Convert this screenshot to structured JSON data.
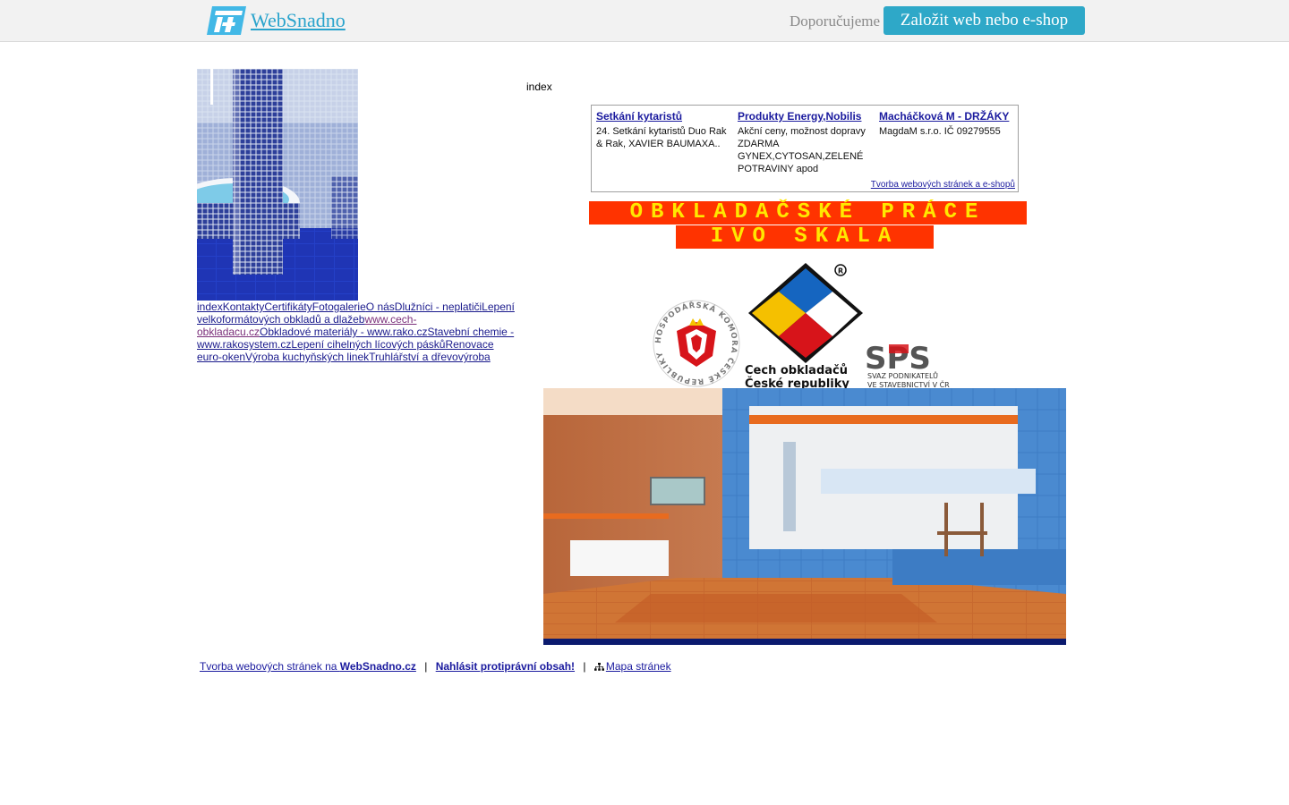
{
  "topbar": {
    "brand_name": "WebSnadno",
    "recommend_label": "Doporučujeme",
    "cta_label": "Založit web nebo e-shop"
  },
  "sidebar": {
    "nav_links": [
      {
        "label": "index"
      },
      {
        "label": "Kontakty"
      },
      {
        "label": "Certifikáty"
      },
      {
        "label": "Fotogalerie"
      },
      {
        "label": "O nás"
      },
      {
        "label": "Dlužníci - neplatiči"
      },
      {
        "label": "Lepení velkoformátových obkladů a dlažeb"
      },
      {
        "label": "www.cech-obkladacu.cz",
        "visited": true
      },
      {
        "label": "Obkladové materiály - www.rako.cz"
      },
      {
        "label": "Stavební chemie - www.rakosystem.cz"
      },
      {
        "label": "Lepení cihelných lícových pásků"
      },
      {
        "label": "Renovace euro-oken"
      },
      {
        "label": "Výroba kuchyňských linek"
      },
      {
        "label": "Truhlářství a dřevovýroba"
      }
    ]
  },
  "main": {
    "page_label": "index",
    "ads": [
      {
        "title": "Setkání kytaristů",
        "text": "24. Setkání kytaristů Duo Rak & Rak, XAVIER BAUMAXA.."
      },
      {
        "title": "Produkty Energy,Nobilis",
        "text": "Akční ceny, možnost dopravy ZDARMA GYNEX,CYTOSAN,ZELENÉ POTRAVINY apod"
      },
      {
        "title": "Macháčková M - DRŽÁKY",
        "text": "MagdaM s.r.o. IČ 09279555"
      }
    ],
    "ads_footer": "Tvorba webových stránek a e-shopů",
    "banner_line1": "OBKLADAČSKÉ PRÁCE",
    "banner_line2": "IVO SKALA",
    "logos": {
      "chamber_text": "HOSPODÁŘSKÁ KOMORA ČESKÉ REPUBLIKY",
      "guild_line1": "Cech obkladačů",
      "guild_line2": "České republiky",
      "sps_acronym": "SPS",
      "sps_line1": "SVAZ PODNIKATELŮ",
      "sps_line2": "VE STAVEBNICTVÍ V ČR"
    }
  },
  "footer": {
    "builder_prefix": "Tvorba webových stránek na ",
    "builder_brand": "WebSnadno.cz",
    "report_label": "Nahlásit protiprávní obsah!",
    "sitemap_label": "Mapa stránek",
    "sitemap_icon": "sitemap-icon"
  }
}
